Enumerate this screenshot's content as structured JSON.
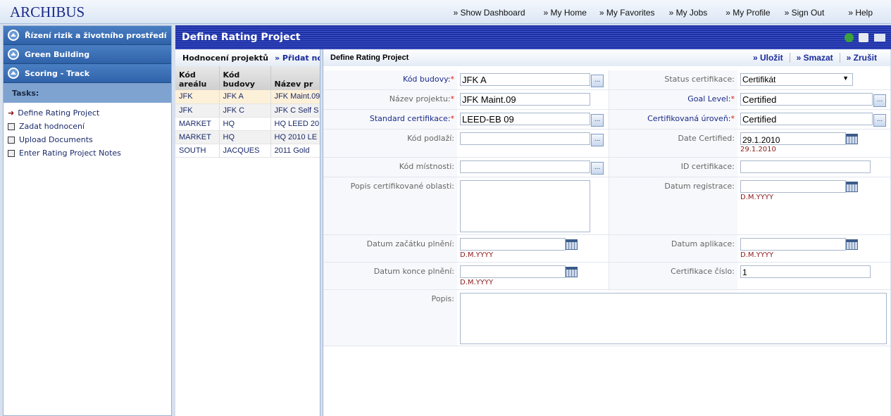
{
  "app": {
    "logo": "ARCHIBUS"
  },
  "nav": [
    "» Show Dashboard",
    "» My Home",
    "» My Favorites",
    "» My Jobs",
    "» My Profile",
    "» Sign Out",
    "» Help"
  ],
  "sidebar": {
    "modules": [
      "Řízení rizik a životního prostředí",
      "Green Building",
      "Scoring - Track"
    ],
    "tasks_header": "Tasks:",
    "tasks": [
      {
        "label": "Define Rating Project",
        "active": true
      },
      {
        "label": "Zadat hodnocení"
      },
      {
        "label": "Upload Documents"
      },
      {
        "label": "Enter Rating Project Notes"
      }
    ]
  },
  "view": {
    "title": "Define Rating Project",
    "icons": [
      "add-icon",
      "print-icon",
      "email-icon"
    ]
  },
  "list": {
    "title": "Hodnocení projektů",
    "add": "» Přidat nový",
    "columns": [
      "Kód areálu",
      "Kód budovy",
      "Název pr"
    ],
    "rows": [
      [
        "JFK",
        "JFK A",
        "JFK Maint.09"
      ],
      [
        "JFK",
        "JFK C",
        "JFK C Self S"
      ],
      [
        "MARKET",
        "HQ",
        "HQ LEED 20"
      ],
      [
        "MARKET",
        "HQ",
        "HQ 2010 LE"
      ],
      [
        "SOUTH",
        "JACQUES",
        "2011 Gold"
      ]
    ]
  },
  "form": {
    "title": "Define Rating Project",
    "actions": [
      "» Uložit",
      "» Smazat",
      "» Zrušit"
    ],
    "f": {
      "bl_id": {
        "label": "Kód budovy:",
        "value": "JFK A"
      },
      "project_name": {
        "label": "Název projektu:",
        "value": "JFK Maint.09"
      },
      "standard": {
        "label": "Standard certifikace:",
        "value": "LEED-EB 09"
      },
      "fl_id": {
        "label": "Kód podlaží:",
        "value": ""
      },
      "rm_id": {
        "label": "Kód místnosti:",
        "value": ""
      },
      "area_desc": {
        "label": "Popis certifikované oblasti:",
        "value": ""
      },
      "date_start": {
        "label": "Datum začátku plnění:",
        "value": "",
        "hint": "D.M.YYYY"
      },
      "date_end": {
        "label": "Datum konce plnění:",
        "value": "",
        "hint": "D.M.YYYY"
      },
      "status": {
        "label": "Status certifikace:",
        "value": "Certifikát"
      },
      "goal": {
        "label": "Goal Level:",
        "value": "Certified"
      },
      "cert_level": {
        "label": "Certifikovaná úroveň:",
        "value": "Certified"
      },
      "date_cert": {
        "label": "Date Certified:",
        "value": "29.1.2010",
        "hint": "29.1.2010"
      },
      "cert_id": {
        "label": "ID certifikace:",
        "value": ""
      },
      "date_reg": {
        "label": "Datum registrace:",
        "value": "",
        "hint": "D.M.YYYY"
      },
      "date_app": {
        "label": "Datum aplikace:",
        "value": "",
        "hint": "D.M.YYYY"
      },
      "cert_num": {
        "label": "Certifikace číslo:",
        "value": "1"
      },
      "desc": {
        "label": "Popis:",
        "value": ""
      }
    }
  }
}
